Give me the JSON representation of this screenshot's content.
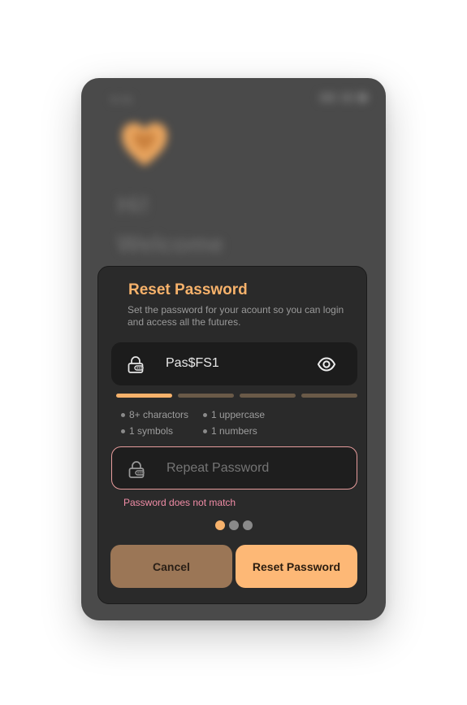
{
  "background_app": {
    "time": "9:41",
    "greeting": "Hi!",
    "welcome": "Welcome"
  },
  "dialog": {
    "title": "Reset Password",
    "subtitle": "Set the password for your acount so you can login and access all the futures.",
    "password_field": {
      "value": "Pas$FS1",
      "lock_icon": "lock-icon",
      "toggle_icon": "eye-icon"
    },
    "strength": {
      "segments_total": 4,
      "segments_filled": 1,
      "active_color": "#f7b26b",
      "inactive_color": "#6a5a48"
    },
    "rules": [
      "8+ charactors",
      "1 uppercase",
      "1 symbols",
      "1 numbers"
    ],
    "repeat_field": {
      "placeholder": "Repeat Password",
      "value": "",
      "lock_icon": "lock-icon",
      "border_color": "#e79c9c"
    },
    "error": "Password does not match",
    "pager": {
      "total": 3,
      "active": 1
    },
    "buttons": {
      "cancel": "Cancel",
      "reset": "Reset Password"
    }
  },
  "colors": {
    "accent": "#f7b26b",
    "card_bg": "#2a2a2a",
    "error": "#f08ca6"
  }
}
